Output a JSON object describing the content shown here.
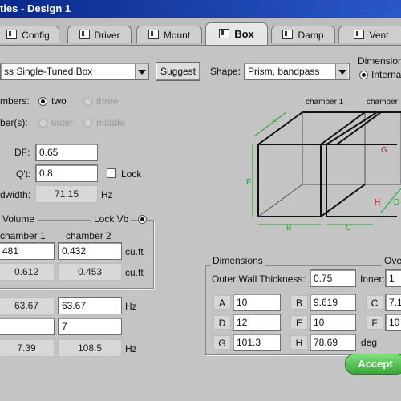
{
  "window": {
    "title": "ties - Design 1"
  },
  "tabs": [
    {
      "label": "Config",
      "icon": "config-icon"
    },
    {
      "label": "Driver",
      "icon": "driver-icon"
    },
    {
      "label": "Mount",
      "icon": "mount-icon"
    },
    {
      "label": "Box",
      "icon": "box-icon",
      "active": true
    },
    {
      "label": "Damp",
      "icon": "damp-icon"
    },
    {
      "label": "Vent",
      "icon": "vent-icon"
    }
  ],
  "box_type": {
    "value": "ss Single-Tuned Box",
    "suggest_label": "Suggest"
  },
  "shape": {
    "label": "Shape:",
    "value": "Prism, bandpass"
  },
  "dimensions_mode": {
    "label": "Dimension",
    "option": "Interna"
  },
  "chambers": {
    "label": "mbers:",
    "opt_two": "two",
    "opt_three": "three"
  },
  "chamber_sel": {
    "label": "ber(s):",
    "opt_outer": "outer",
    "opt_middle": "middle"
  },
  "df": {
    "label": "DF:",
    "value": "0.65"
  },
  "qt": {
    "label": "Q't:",
    "value": "0.8",
    "lock_label": "Lock"
  },
  "bandwidth": {
    "label": "dwidth:",
    "value": "71.15",
    "unit": "Hz"
  },
  "volume": {
    "label": "Volume",
    "lock_label": "Lock Vb",
    "col1": "chamber 1",
    "col2": "chamber 2",
    "row1": [
      "481",
      "0.432"
    ],
    "row1_unit": "cu.ft",
    "row2": [
      "0.612",
      "0.453"
    ],
    "row2_unit": "cu.ft"
  },
  "tuning": {
    "row1": [
      "63.67",
      "63.67"
    ],
    "row1_unit": "Hz",
    "row2": [
      "",
      "7"
    ],
    "row3": [
      "7.39",
      "108.5"
    ],
    "row3_unit": "Hz"
  },
  "diagram": {
    "chamber1": "chamber 1",
    "chamber2": "chamber",
    "labels": [
      "E",
      "F",
      "B",
      "C",
      "G",
      "H",
      "D"
    ]
  },
  "dimensions": {
    "label": "Dimensions",
    "outer_wall_label": "Outer Wall Thickness:",
    "outer_wall": "0.75",
    "over_label": "Ove",
    "inner_label": "Inner:",
    "inner": "1",
    "A": "10",
    "B": "9.619",
    "C": "7.1",
    "D": "12",
    "E": "10",
    "F": "10",
    "G": "101.3",
    "H": "78.69",
    "angle_unit": "deg"
  },
  "accept_label": "Accept"
}
